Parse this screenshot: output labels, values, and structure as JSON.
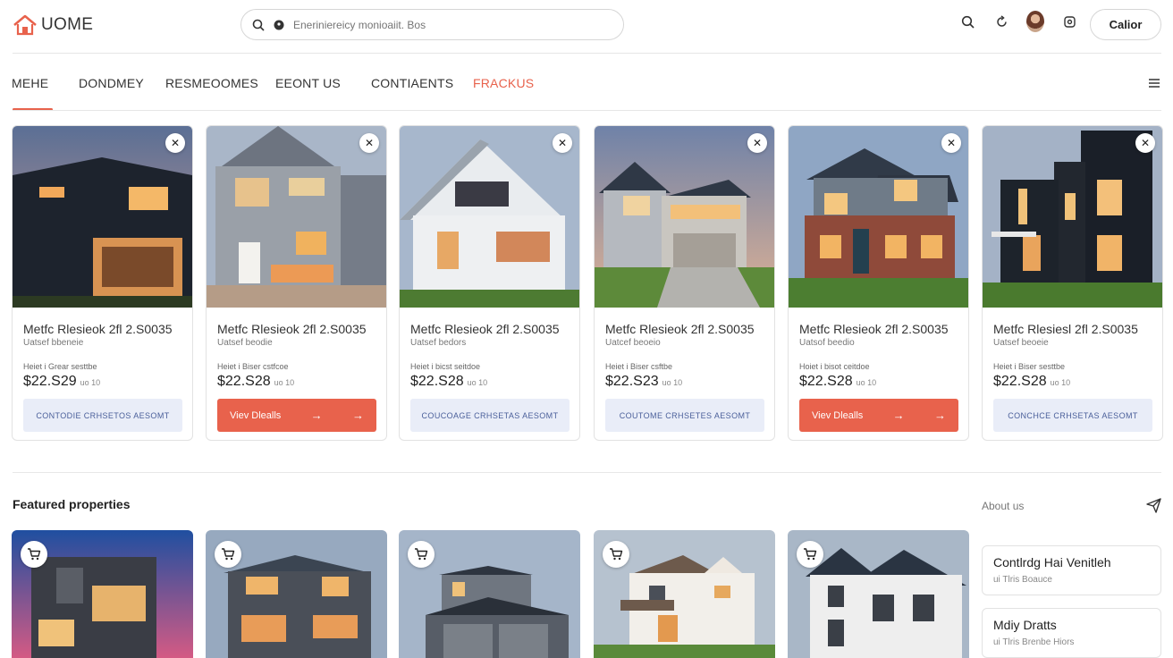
{
  "header": {
    "logo_text": "UOME",
    "search_placeholder": "Eneriniereicy monioaiit. Bos",
    "button_label": "Calior"
  },
  "nav": {
    "items": [
      {
        "label": "MEHE",
        "active": false
      },
      {
        "label": "DONDMEY",
        "active": false
      },
      {
        "label": "RESMEOOMES",
        "active": false
      },
      {
        "label": "EEONT US",
        "active": false
      },
      {
        "label": "CONTIAENTS",
        "active": false
      },
      {
        "label": "FRACKUS",
        "active": true
      }
    ]
  },
  "listings": [
    {
      "title": "Metfc Rlesieok 2fl 2.S0035",
      "subtitle": "Uatsef bbeneie",
      "meta": "Heiet i Grear sesttbe",
      "price": "$22.S29",
      "unit": "uo 10",
      "button": "CONTODIE CRHSETOS AESOMT",
      "button_style": "light"
    },
    {
      "title": "Metfc Rlesieok 2fl 2.S0035",
      "subtitle": "Uatsef beodie",
      "meta": "Heiet i Biser cstfcoe",
      "price": "$22.S28",
      "unit": "uo 10",
      "button": "Viev Dlealls",
      "button_style": "primary"
    },
    {
      "title": "Metfc Rlesieok 2fl 2.S0035",
      "subtitle": "Uatsef bedors",
      "meta": "Heiet i bicst seitdoe",
      "price": "$22.S28",
      "unit": "uo 10",
      "button": "COUCOAGE CRHSETAS AESOMT",
      "button_style": "light"
    },
    {
      "title": "Metfc Rlesieok 2fl 2.S0035",
      "subtitle": "Uatcef beoeio",
      "meta": "Heiet i Biser csftbe",
      "price": "$22.S23",
      "unit": "uo 10",
      "button": "COUTOME CRHSETES AESOMT",
      "button_style": "light"
    },
    {
      "title": "Metfc Rlesieok 2fl 2.S0035",
      "subtitle": "Uatsof beedio",
      "meta": "Hoiet i bisot ceitdoe",
      "price": "$22.S28",
      "unit": "uo 10",
      "button": "Viev Dlealls",
      "button_style": "primary"
    },
    {
      "title": "Metfc Rlesiesl 2fl 2.S0035",
      "subtitle": "Uatsef beoeie",
      "meta": "Heiet i Biser sesttbe",
      "price": "$22.S28",
      "unit": "uo 10",
      "button": "CONCHCE CRHSETAS AESOMT",
      "button_style": "light"
    }
  ],
  "featured": {
    "title": "Featured properties",
    "about_label": "About us"
  },
  "side_boxes": [
    {
      "title": "Contlrdg Hai Venitleh",
      "sub": "ui Tlris Boauce"
    },
    {
      "title": "Mdiy Dratts",
      "sub": "ui Tlris Brenbe Hiors"
    }
  ],
  "colors": {
    "accent": "#e8624c",
    "light_button": "#e9edf8",
    "light_button_text": "#4a5f9a"
  }
}
